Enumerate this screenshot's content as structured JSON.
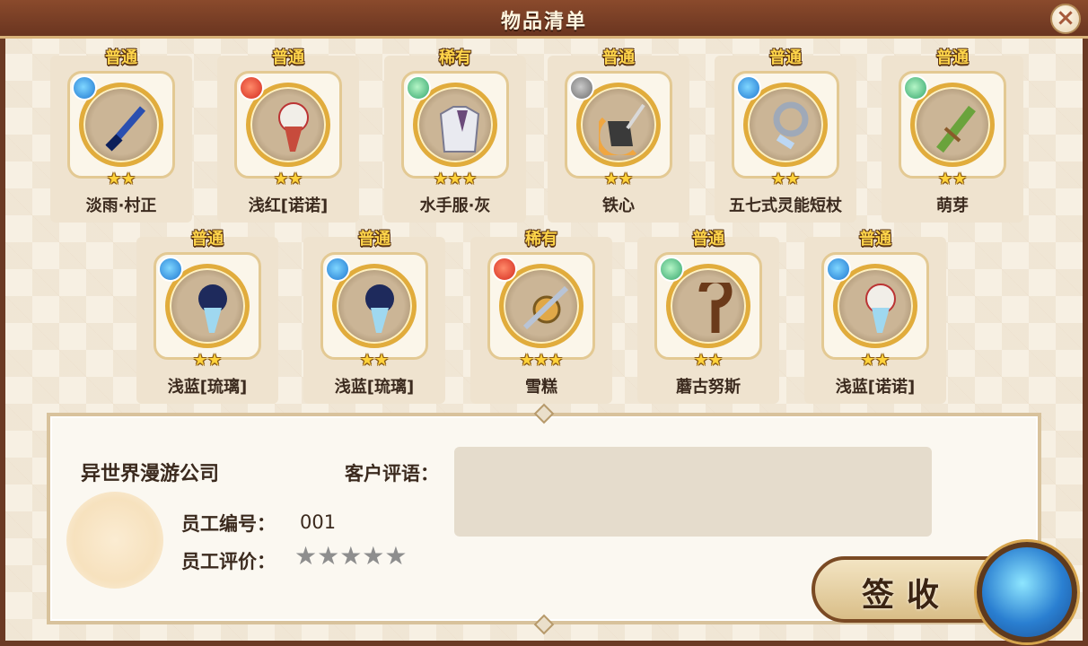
{
  "header": {
    "title": "物品清单",
    "close_symbol": "×"
  },
  "items_row1": [
    {
      "rarity": "普通",
      "name": "淡雨·村正",
      "stars": "★★",
      "element": "water"
    },
    {
      "rarity": "普通",
      "name": "浅红[诺诺]",
      "stars": "★★",
      "element": "fire"
    },
    {
      "rarity": "稀有",
      "name": "水手服·灰",
      "stars": "★★★",
      "element": "wind"
    },
    {
      "rarity": "普通",
      "name": "铁心",
      "stars": "★★",
      "element": "metal"
    },
    {
      "rarity": "普通",
      "name": "五七式灵能短杖",
      "stars": "★★",
      "element": "water"
    },
    {
      "rarity": "普通",
      "name": "萌芽",
      "stars": "★★",
      "element": "wind"
    }
  ],
  "items_row2": [
    {
      "rarity": "普通",
      "name": "浅蓝[琉璃]",
      "stars": "★★",
      "element": "water"
    },
    {
      "rarity": "普通",
      "name": "浅蓝[琉璃]",
      "stars": "★★",
      "element": "water"
    },
    {
      "rarity": "稀有",
      "name": "雪糕",
      "stars": "★★★",
      "element": "fire"
    },
    {
      "rarity": "普通",
      "name": "蘑古努斯",
      "stars": "★★",
      "element": "wind"
    },
    {
      "rarity": "普通",
      "name": "浅蓝[诺诺]",
      "stars": "★★",
      "element": "water"
    }
  ],
  "panel": {
    "company": "异世界漫游公司",
    "employee_id_label": "员工编号：",
    "employee_id": "001",
    "rating_label": "员工评价：",
    "rating_stars": "★★★★★",
    "comment_label": "客户评语：",
    "comment_text": ""
  },
  "actions": {
    "sign_label": "签收"
  }
}
